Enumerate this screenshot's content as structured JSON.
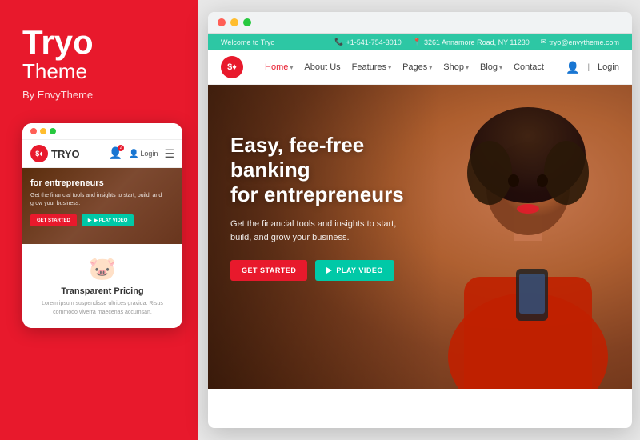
{
  "leftPanel": {
    "brandTitle": "Tryo",
    "brandSubtitle": "Theme",
    "brandBy": "By EnvyTheme"
  },
  "mobile": {
    "dots": [
      {
        "color": "#ff5f56"
      },
      {
        "color": "#ffbd2e"
      },
      {
        "color": "#27c93f"
      }
    ],
    "logoText": "TRYO",
    "heroText": "for entrepreneurs",
    "heroSub": "Get the financial tools and insights to start, build, and grow your business.",
    "btnGetStarted": "GET STARTED",
    "btnPlayVideo": "▶ PLAY VIDEO",
    "sectionTitle": "Transparent Pricing",
    "sectionText": "Lorem ipsum suspendisse ultrices gravida. Risus commodo viverra maecenas accumsan."
  },
  "browser": {
    "dots": [
      {
        "color": "#ff5f56"
      },
      {
        "color": "#ffbd2e"
      },
      {
        "color": "#27c93f"
      }
    ],
    "topBar": {
      "welcome": "Welcome to Tryo",
      "phone": "+1-541-754-3010",
      "address": "3261 Annamore Road, NY 11230",
      "email": "tryo@envytheme.com"
    },
    "nav": {
      "logoText": "$♦",
      "links": [
        {
          "label": "Home",
          "active": true,
          "hasChevron": true
        },
        {
          "label": "About Us",
          "active": false,
          "hasChevron": false
        },
        {
          "label": "Features",
          "active": false,
          "hasChevron": true
        },
        {
          "label": "Pages",
          "active": false,
          "hasChevron": true
        },
        {
          "label": "Shop",
          "active": false,
          "hasChevron": true
        },
        {
          "label": "Blog",
          "active": false,
          "hasChevron": true
        },
        {
          "label": "Contact",
          "active": false,
          "hasChevron": false
        }
      ],
      "loginLabel": "Login"
    },
    "hero": {
      "title": "Easy, fee-free banking\nfor entrepreneurs",
      "description": "Get the financial tools and insights to start,\nbuild, and grow your business.",
      "btnGetStarted": "GET STARTED",
      "btnPlayVideo": "PLAY VIDEO"
    }
  }
}
